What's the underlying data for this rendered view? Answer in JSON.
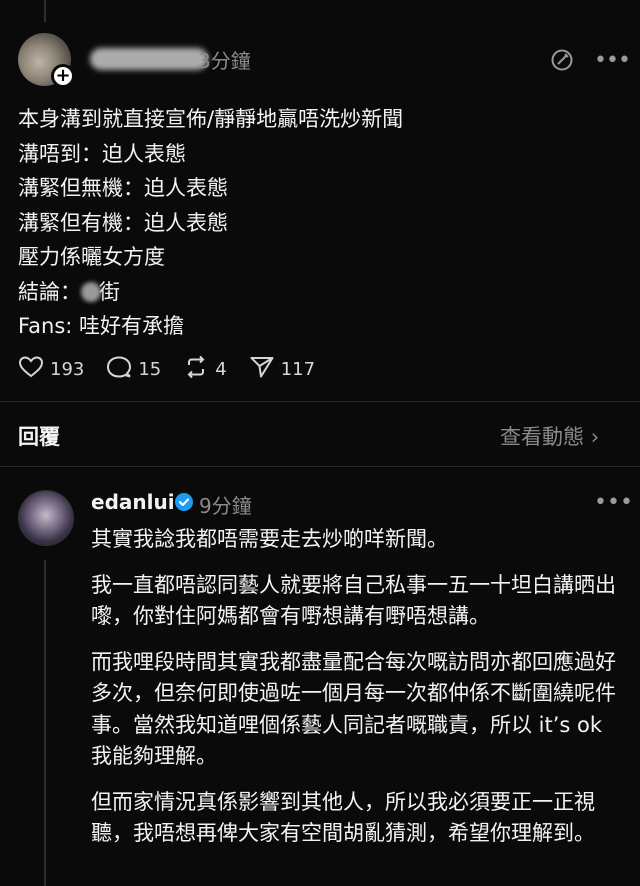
{
  "post": {
    "time": "3分鐘",
    "lines": [
      "本身溝到就直接宣佈/靜靜地贏唔洗炒新聞",
      "溝唔到：迫人表態",
      "溝緊但無機：迫人表態",
      "溝緊但有機：迫人表態",
      "壓力係曬女方度",
      "結論：",
      "Fans: 哇好有承擔"
    ],
    "conclusion_suffix": "街",
    "stats": {
      "likes": "193",
      "comments": "15",
      "reposts": "4",
      "shares": "117"
    }
  },
  "reply_section": {
    "label": "回覆",
    "view_activity": "查看動態",
    "view_activity_chevron": "›"
  },
  "reply": {
    "username": "edanlui",
    "time": "9分鐘",
    "more": "•••",
    "paragraphs": [
      "其實我諗我都唔需要走去炒啲咩新聞。",
      "我一直都唔認同藝人就要將自己私事一五一十坦白講晒出嚟，你對住阿媽都會有嘢想講有嘢唔想講。",
      "而我哩段時間其實我都盡量配合每次嘅訪問亦都回應過好多次，但奈何即使過咗一個月每一次都仲係不斷圍繞呢件事。當然我知道哩個係藝人同記者嘅職責，所以 it’s ok 我能夠理解。",
      "但而家情況真係影響到其他人，所以我必須要正一正視聽，我唔想再俾大家有空間胡亂猜測，希望你理解到。"
    ]
  },
  "icons": {
    "like": "heart-icon",
    "comment": "comment-icon",
    "repost": "repost-icon",
    "share": "send-icon",
    "edit": "edit-icon",
    "verified": "verified-badge-icon"
  },
  "colors": {
    "background": "#0a0a0a",
    "text": "#f3f3f3",
    "muted": "#8a8a8a",
    "verified": "#1d9bf0"
  }
}
